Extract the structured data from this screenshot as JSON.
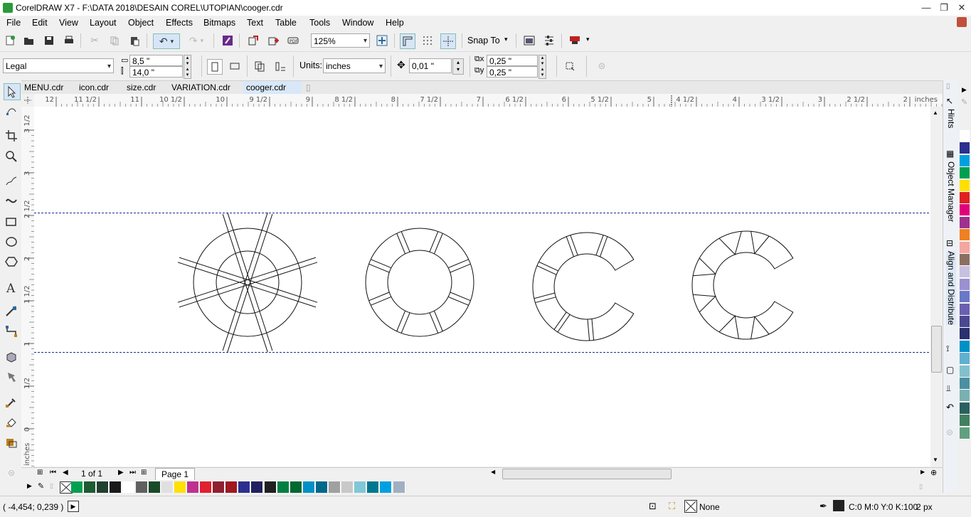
{
  "window": {
    "title": "CorelDRAW X7 - F:\\DATA 2018\\DESAIN COREL\\UTOPIAN\\cooger.cdr"
  },
  "menu": [
    "File",
    "Edit",
    "View",
    "Layout",
    "Object",
    "Effects",
    "Bitmaps",
    "Text",
    "Table",
    "Tools",
    "Window",
    "Help"
  ],
  "toolbar": {
    "zoom": "125%",
    "snap_to": "Snap To"
  },
  "property_bar": {
    "page_size": "Legal",
    "width": "8,5 \"",
    "height": "14,0 \"",
    "units_label": "Units:",
    "units": "inches",
    "nudge": "0,01 \"",
    "dup_x": "0,25 \"",
    "dup_y": "0,25 \""
  },
  "tabs": [
    "MENU.cdr",
    "icon.cdr",
    "size.cdr",
    "VARIATION.cdr",
    "cooger.cdr"
  ],
  "active_tab": "cooger.cdr",
  "hruler_labels": [
    "12",
    "11 1/2",
    "11",
    "10 1/2",
    "10",
    "9 1/2",
    "9",
    "8 1/2",
    "8",
    "7 1/2",
    "7",
    "6 1/2",
    "6",
    "5 1/2",
    "5",
    "4 1/2",
    "4",
    "3 1/2",
    "3",
    "2 1/2",
    "2",
    "inches"
  ],
  "vruler_labels": [
    "3 1/2",
    "3",
    "2 1/2",
    "2",
    "1 1/2",
    "1",
    "1/2",
    "0",
    "inches"
  ],
  "dockers": [
    "Hints",
    "Object Manager",
    "Align and Distribute"
  ],
  "page_nav": {
    "count": "1 of 1",
    "page": "Page 1"
  },
  "status": {
    "coords": "( -4,454; 0,239 )",
    "fill": "None",
    "outline": "C:0 M:0 Y:0 K:100",
    "outline_width": "2 px"
  },
  "colors": {
    "guide": "#1a2a9a",
    "right_palette": [
      "#ffffff",
      "#2b2f8f",
      "#00a0e0",
      "#00a050",
      "#ffe000",
      "#e02020",
      "#e0007a",
      "#a03090",
      "#f08020",
      "#f4a6a0",
      "#8c6e60",
      "#c8c0e0",
      "#9b90d0",
      "#6a78c8",
      "#6a60b0",
      "#4a4890",
      "#2a3070",
      "#0090c8",
      "#60b0d0",
      "#80c0cc",
      "#4a90a0",
      "#7ab0b0",
      "#2a6060",
      "#408060",
      "#60a080"
    ],
    "bottom_palette": [
      "#00a050",
      "#1e5a32",
      "#204030",
      "#1a1a1a",
      "#ffffff",
      "#606060",
      "#1a4a2a",
      "#e0e0e0",
      "#ffe000",
      "#c03090",
      "#e02030",
      "#902030",
      "#a01820",
      "#2b2f8f",
      "#202060",
      "#202020",
      "#008040",
      "#006830",
      "#0090c8",
      "#006888",
      "#a0a0a0",
      "#c8c8c8",
      "#80c8d8",
      "#007890",
      "#00a0e0",
      "#a0b0c0"
    ]
  }
}
